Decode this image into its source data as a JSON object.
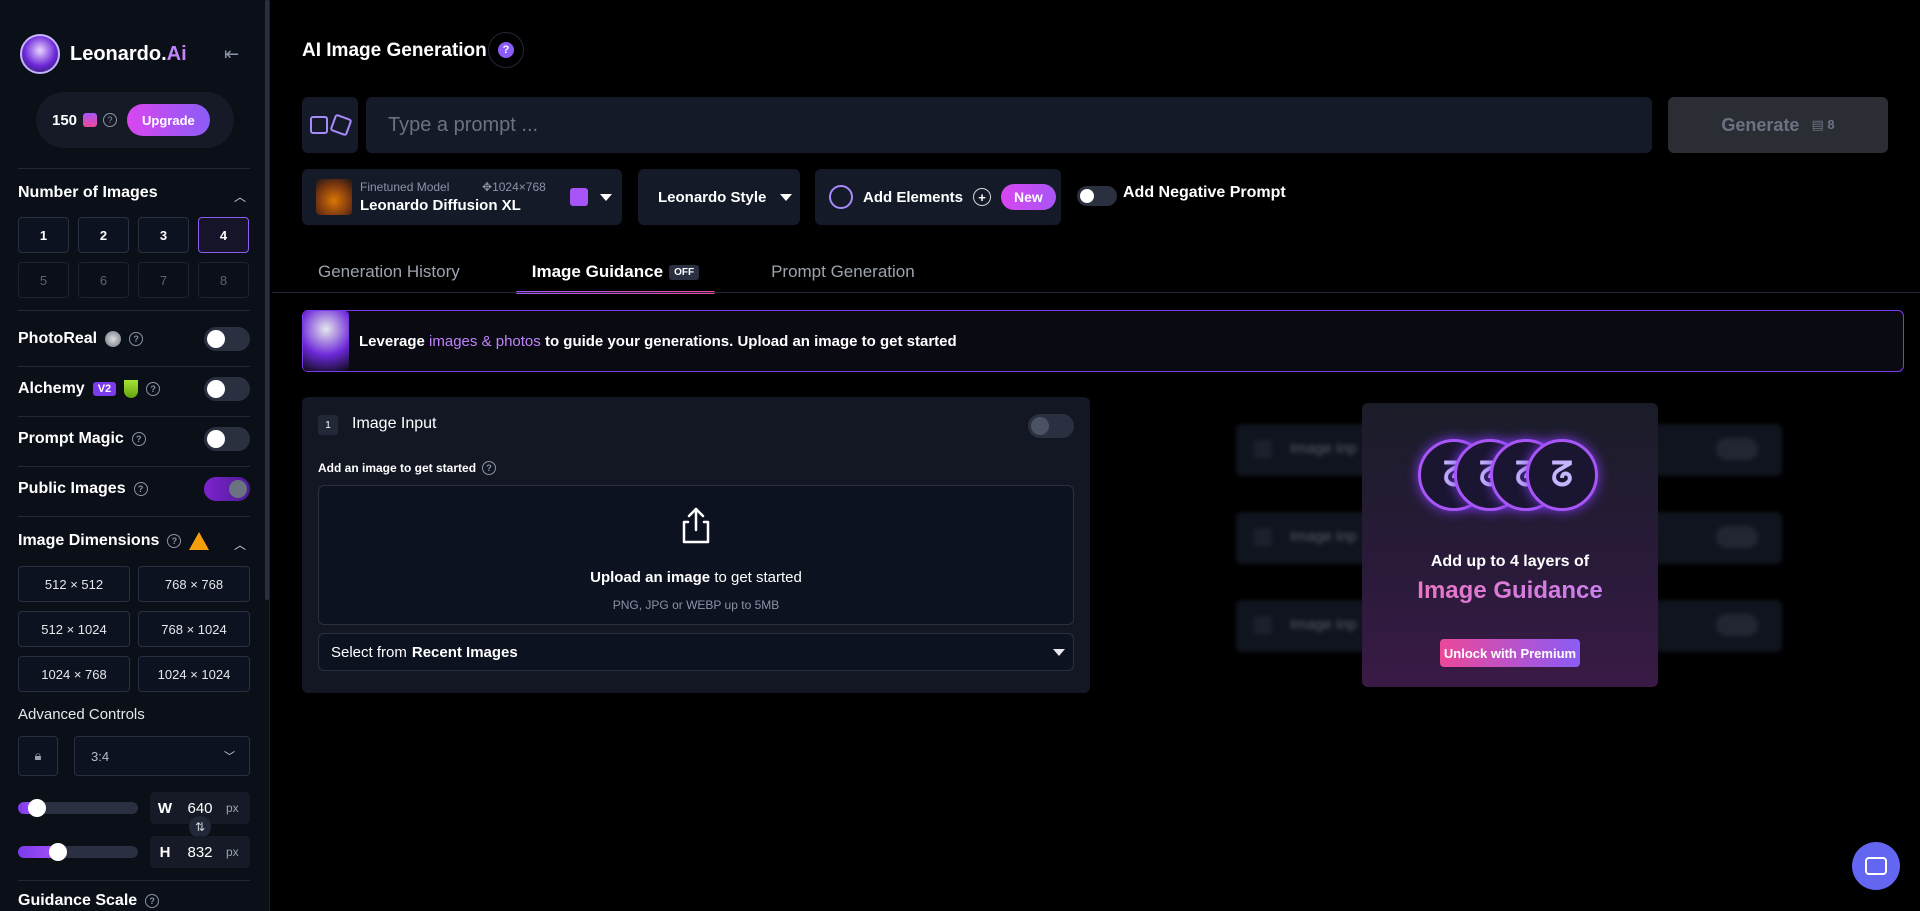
{
  "sidebar": {
    "brand": {
      "name": "Leonardo.",
      "suffix": "Ai"
    },
    "credits": {
      "count": "150",
      "upgrade_label": "Upgrade"
    },
    "number_of_images": {
      "title": "Number of Images",
      "options": [
        "1",
        "2",
        "3",
        "4",
        "5",
        "6",
        "7",
        "8"
      ],
      "selected": "4"
    },
    "toggles": {
      "photoreal": "PhotoReal",
      "alchemy": "Alchemy",
      "alchemy_badge": "V2",
      "prompt_magic": "Prompt Magic",
      "public_images": "Public Images"
    },
    "image_dimensions": {
      "title": "Image Dimensions",
      "options": [
        "512 × 512",
        "768 × 768",
        "512 × 1024",
        "768 × 1024",
        "1024 × 768",
        "1024 × 1024"
      ]
    },
    "advanced": {
      "label": "Advanced Controls",
      "aspect_ratio": "3:4",
      "width_label": "W",
      "width_value": "640",
      "height_label": "H",
      "height_value": "832",
      "unit": "px",
      "width_slider_fraction": 0.1,
      "height_slider_fraction": 0.3
    },
    "guidance_scale": "Guidance Scale"
  },
  "header": {
    "title": "AI Image Generation",
    "help_glyph": "?"
  },
  "prompt": {
    "placeholder": "Type a prompt ...",
    "generate_label": "Generate",
    "generate_cost": "8"
  },
  "model": {
    "subtitle": "Finetuned Model",
    "resolution": "1024×768",
    "name": "Leonardo Diffusion XL"
  },
  "style": {
    "label": "Leonardo Style"
  },
  "elements": {
    "label": "Add Elements",
    "badge": "New"
  },
  "negative_prompt": {
    "label": "Add Negative Prompt"
  },
  "tabs": [
    {
      "label": "Generation History"
    },
    {
      "label": "Image Guidance",
      "badge": "OFF"
    },
    {
      "label": "Prompt Generation"
    }
  ],
  "banner": {
    "prefix": "Leverage",
    "highlight": "images & photos",
    "suffix": "to guide your generations. Upload an image to get started"
  },
  "image_input": {
    "step": "1",
    "title": "Image Input",
    "add_label": "Add an image to get started",
    "upload_bold": "Upload an image",
    "upload_rest": "to get started",
    "formats": "PNG, JPG or WEBP up to 5MB",
    "recent_prefix": "Select from",
    "recent_bold": "Recent Images"
  },
  "ghost_cards": [
    "Image Inp",
    "Image Inp",
    "Image Inp"
  ],
  "promo": {
    "line1": "Add up to 4 layers of",
    "line2": "Image Guidance",
    "button": "Unlock with Premium"
  },
  "colors": {
    "accent_purple": "#8b5cf6",
    "accent_pink": "#ec4899",
    "background": "#000000",
    "sidebar": "#0b0f17"
  }
}
